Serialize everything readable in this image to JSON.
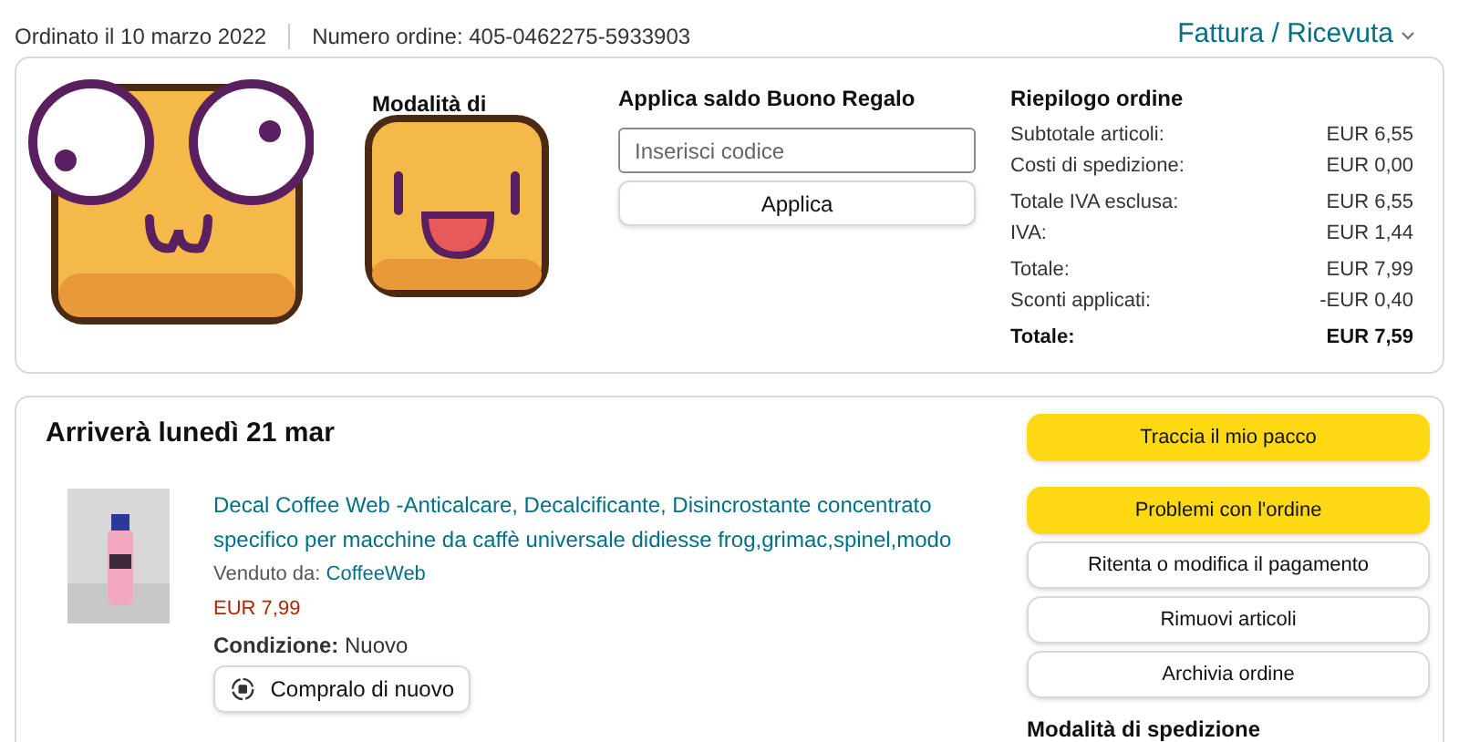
{
  "header": {
    "ordered": "Ordinato il 10 marzo 2022",
    "order_number": "Numero ordine: 405-0462275-5933903",
    "invoice_link": "Fattura / Ricevuta"
  },
  "summary_card": {
    "shipping_heading": "Modalità di",
    "gift_card": {
      "heading": "Applica saldo Buono Regalo",
      "placeholder": "Inserisci codice",
      "button": "Applica"
    },
    "order_summary": {
      "heading": "Riepilogo ordine",
      "rows": [
        {
          "label": "Subtotale articoli:",
          "value": "EUR 6,55",
          "bold": false
        },
        {
          "label": "Costi di spedizione:",
          "value": "EUR 0,00",
          "bold": false
        },
        {
          "label": "Totale IVA esclusa:",
          "value": "EUR 6,55",
          "bold": false
        },
        {
          "label": "IVA:",
          "value": "EUR 1,44",
          "bold": false
        },
        {
          "label": "Totale:",
          "value": "EUR 7,99",
          "bold": false
        },
        {
          "label": "Sconti applicati:",
          "value": "-EUR 0,40",
          "bold": false
        },
        {
          "label": "Totale:",
          "value": "EUR 7,59",
          "bold": true
        }
      ]
    }
  },
  "shipment": {
    "heading": "Arriverà lunedì 21 mar",
    "item": {
      "title": "Decal Coffee Web -Anticalcare, Decalcificante, Disincrostante concentrato specifico per macchine da caffè universale didiesse frog,grimac,spinel,modo",
      "sold_by_label": "Venduto da:",
      "seller": "CoffeeWeb",
      "price": "EUR 7,99",
      "condition_label": "Condizione:",
      "condition": "Nuovo",
      "buy_again": "Compralo di nuovo"
    },
    "actions": [
      {
        "label": "Traccia il mio pacco",
        "kind": "primary"
      },
      {
        "label": "Problemi con l'ordine",
        "kind": "primary"
      },
      {
        "label": "Ritenta o modifica il pagamento",
        "kind": "secondary"
      },
      {
        "label": "Rimuovi articoli",
        "kind": "secondary"
      },
      {
        "label": "Archivia ordine",
        "kind": "secondary"
      }
    ],
    "shipping_method_heading": "Modalità di spedizione"
  }
}
